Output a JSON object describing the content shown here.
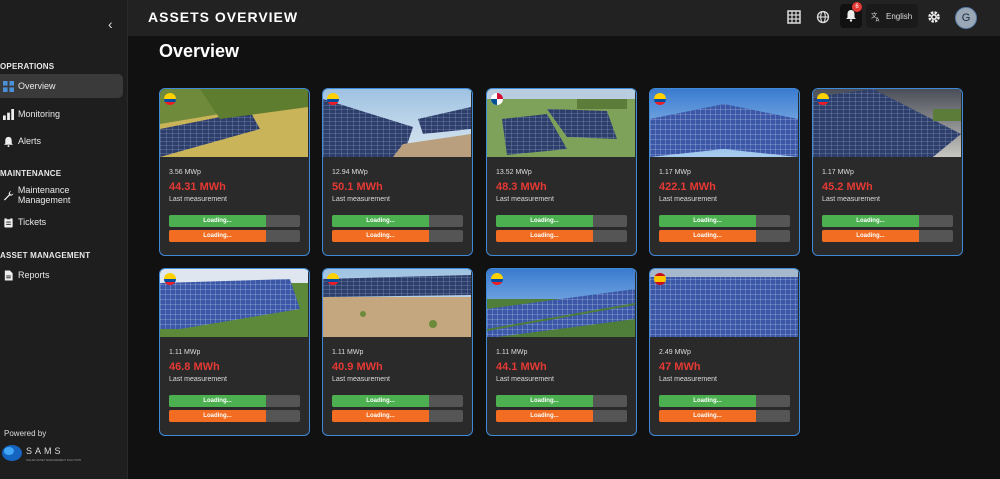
{
  "header": {
    "title": "ASSETS OVERVIEW",
    "language": "English",
    "notifications": "6",
    "avatar_letter": "G"
  },
  "page": {
    "title": "Overview"
  },
  "sidebar": {
    "sections": [
      "OPERATIONS",
      "MAINTENANCE",
      "ASSET MANAGEMENT"
    ],
    "items": [
      "Overview",
      "Monitoring",
      "Alerts",
      "Maintenance Management",
      "Tickets",
      "Reports"
    ],
    "active": "Overview",
    "powered_by": "Powered by",
    "logo_text": "SAMS",
    "logo_tagline": "SOLAR ASSET MANAGEMENT SOLUTION"
  },
  "assets": [
    {
      "capacity": "3.56 MWp",
      "energy": "44.31 MWh",
      "label": "Last measurement",
      "bar1": "Loading...",
      "bar2": "Loading...",
      "progress1": 0.74,
      "progress2": 0.74,
      "flag": "ecuador"
    },
    {
      "capacity": "12.94 MWp",
      "energy": "50.1 MWh",
      "label": "Last measurement",
      "bar1": "Loading...",
      "bar2": "Loading...",
      "progress1": 0.74,
      "progress2": 0.74,
      "flag": "ecuador"
    },
    {
      "capacity": "13.52 MWp",
      "energy": "48.3 MWh",
      "label": "Last measurement",
      "bar1": "Loading...",
      "bar2": "Loading...",
      "progress1": 0.74,
      "progress2": 0.74,
      "flag": "panama"
    },
    {
      "capacity": "1.17 MWp",
      "energy": "422.1 MWh",
      "label": "Last measurement",
      "bar1": "Loading...",
      "bar2": "Loading...",
      "progress1": 0.74,
      "progress2": 0.74,
      "flag": "ecuador"
    },
    {
      "capacity": "1.17 MWp",
      "energy": "45.2 MWh",
      "label": "Last measurement",
      "bar1": "Loading...",
      "bar2": "Loading...",
      "progress1": 0.74,
      "progress2": 0.74,
      "flag": "ecuador"
    },
    {
      "capacity": "1.11 MWp",
      "energy": "46.8 MWh",
      "label": "Last measurement",
      "bar1": "Loading...",
      "bar2": "Loading...",
      "progress1": 0.74,
      "progress2": 0.74,
      "flag": "ecuador"
    },
    {
      "capacity": "1.11 MWp",
      "energy": "40.9 MWh",
      "label": "Last measurement",
      "bar1": "Loading...",
      "bar2": "Loading...",
      "progress1": 0.74,
      "progress2": 0.74,
      "flag": "ecuador"
    },
    {
      "capacity": "1.11 MWp",
      "energy": "44.1 MWh",
      "label": "Last measurement",
      "bar1": "Loading...",
      "bar2": "Loading...",
      "progress1": 0.74,
      "progress2": 0.74,
      "flag": "ecuador"
    },
    {
      "capacity": "2.49 MWp",
      "energy": "47 MWh",
      "label": "Last measurement",
      "bar1": "Loading...",
      "bar2": "Loading...",
      "progress1": 0.74,
      "progress2": 0.74,
      "flag": "spain"
    }
  ],
  "colors": {
    "accent_border": "#3f8ad8",
    "energy_red": "#e53935",
    "bar_green": "#4caf50",
    "bar_orange": "#f26d21"
  }
}
